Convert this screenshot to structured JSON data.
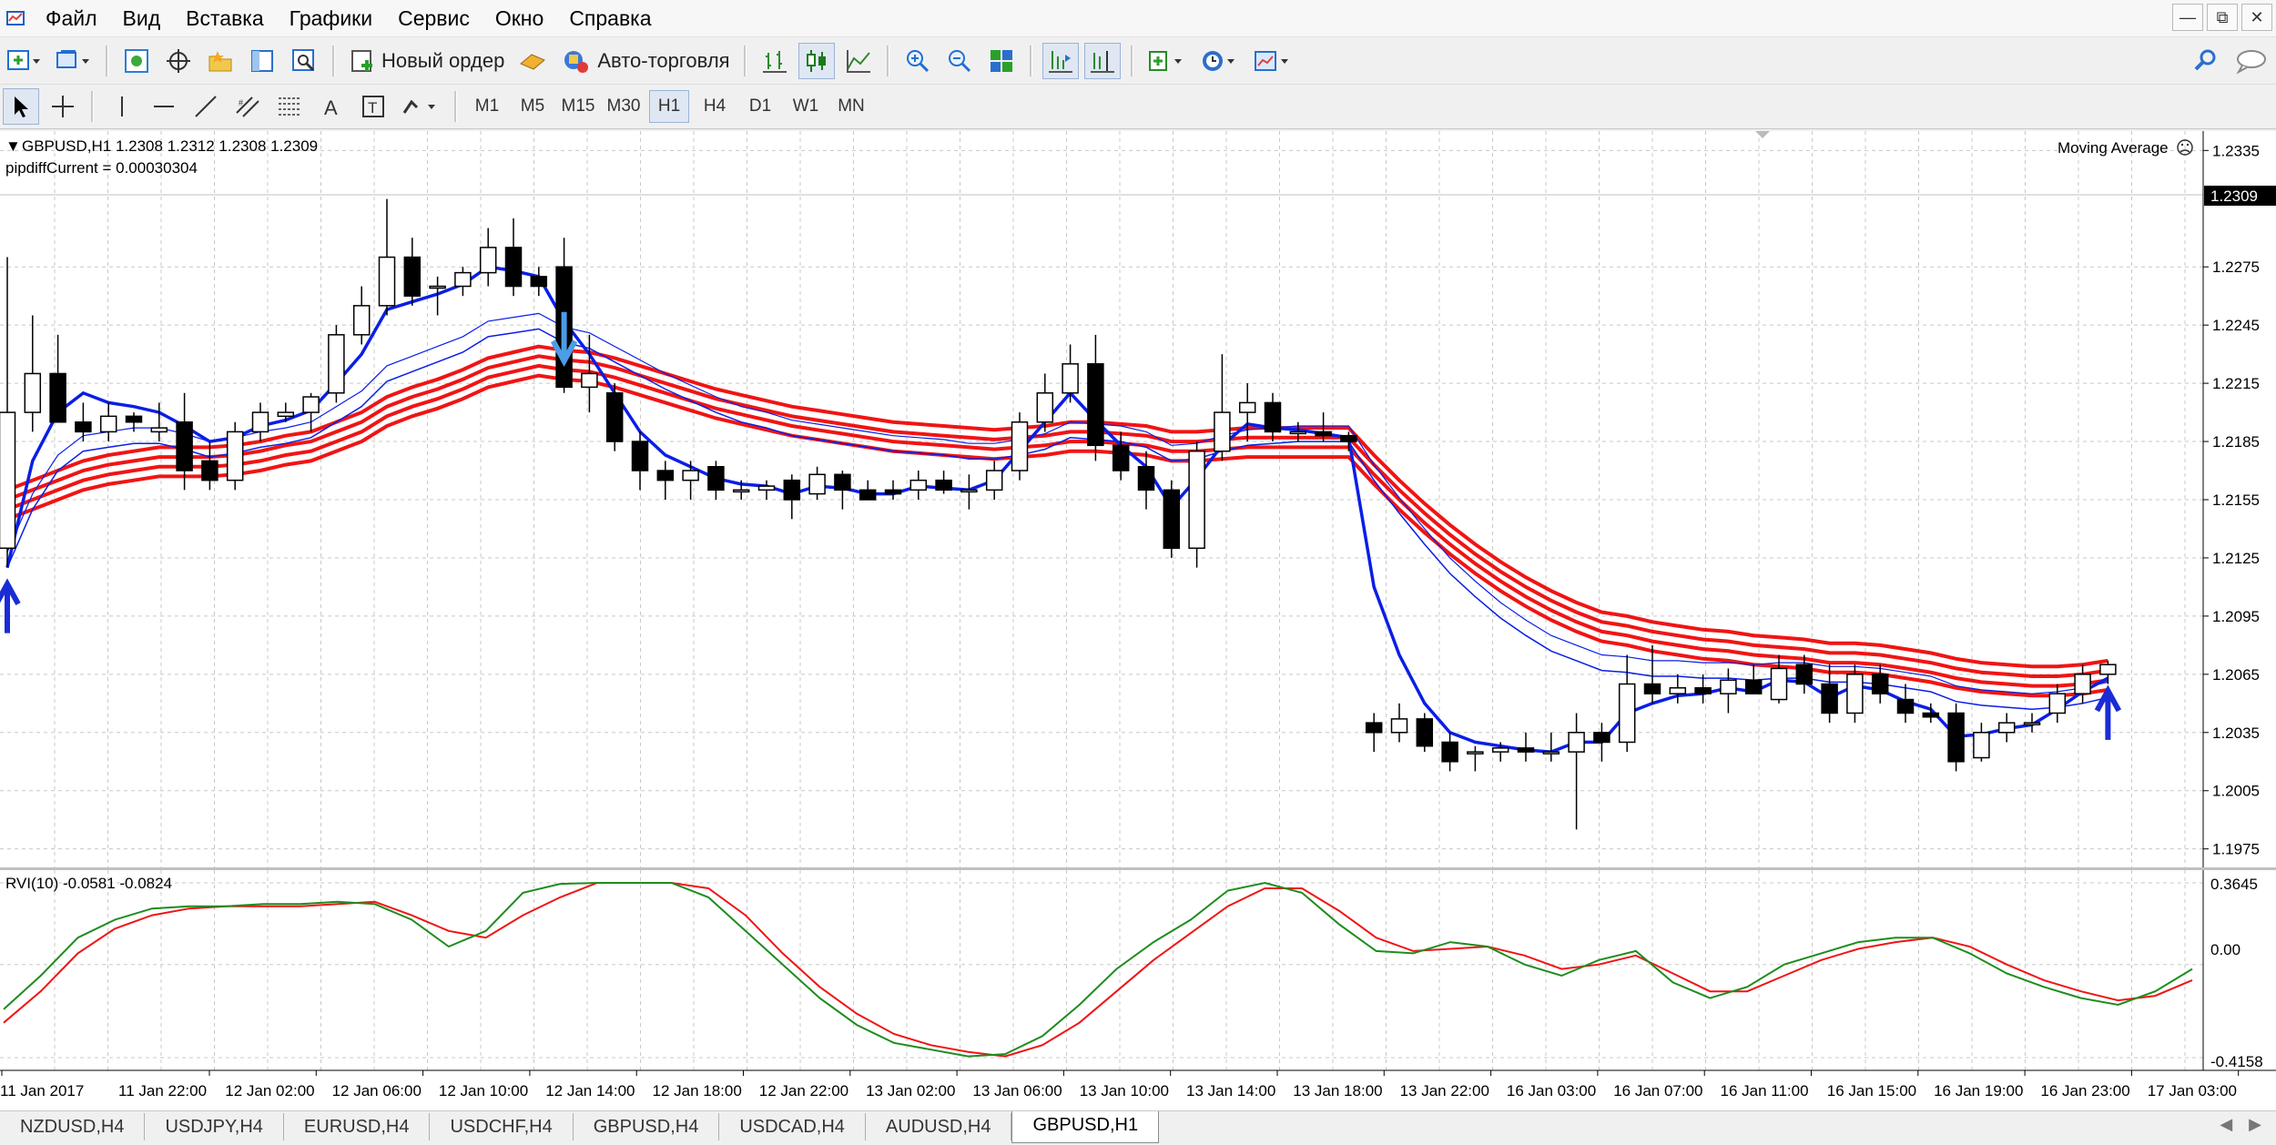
{
  "menu": {
    "items": [
      "Файл",
      "Вид",
      "Вставка",
      "Графики",
      "Сервис",
      "Окно",
      "Справка"
    ]
  },
  "toolbar": {
    "new_order_label": "Новый ордер",
    "auto_trading_label": "Авто-торговля"
  },
  "timeframes": [
    "M1",
    "M5",
    "M15",
    "M30",
    "H1",
    "H4",
    "D1",
    "W1",
    "MN"
  ],
  "active_timeframe": "H1",
  "chart": {
    "symbol_info": "GBPUSD,H1  1.2308 1.2312 1.2308 1.2309",
    "pipdiff": "pipdiffCurrent = 0.00030304",
    "indicator_label": "Moving Average",
    "current_price": "1.2309",
    "price_ticks": [
      "1.2335",
      "1.2275",
      "1.2245",
      "1.2215",
      "1.2185",
      "1.2155",
      "1.2125",
      "1.2095",
      "1.2065",
      "1.2035",
      "1.2005",
      "1.1975"
    ],
    "time_ticks": [
      "11 Jan 2017",
      "11 Jan 22:00",
      "12 Jan 02:00",
      "12 Jan 06:00",
      "12 Jan 10:00",
      "12 Jan 14:00",
      "12 Jan 18:00",
      "12 Jan 22:00",
      "13 Jan 02:00",
      "13 Jan 06:00",
      "13 Jan 10:00",
      "13 Jan 14:00",
      "13 Jan 18:00",
      "13 Jan 22:00",
      "16 Jan 03:00",
      "16 Jan 07:00",
      "16 Jan 11:00",
      "16 Jan 15:00",
      "16 Jan 19:00",
      "16 Jan 23:00",
      "17 Jan 03:00"
    ],
    "rvi_label": "RVI(10) -0.0581 -0.0824",
    "rvi_ticks": [
      "0.3645",
      "0.00",
      "-0.4158"
    ]
  },
  "colors": {
    "bull": "#ffffff",
    "bear": "#000000",
    "ma_blue": "#0a1ee6",
    "ma_red": "#f01414",
    "rvi_main": "#1e8c1e",
    "rvi_signal": "#f01414",
    "arrow_up": "#1a2cd6",
    "arrow_down": "#4a9de6"
  },
  "chart_data": {
    "type": "candlestick",
    "symbol": "GBPUSD",
    "timeframe": "H1",
    "ylim": [
      1.1965,
      1.2345
    ],
    "candles": [
      {
        "o": 1.213,
        "h": 1.228,
        "l": 1.212,
        "c": 1.22
      },
      {
        "o": 1.22,
        "h": 1.225,
        "l": 1.219,
        "c": 1.222
      },
      {
        "o": 1.222,
        "h": 1.224,
        "l": 1.22,
        "c": 1.2195
      },
      {
        "o": 1.2195,
        "h": 1.2205,
        "l": 1.2185,
        "c": 1.219
      },
      {
        "o": 1.219,
        "h": 1.2205,
        "l": 1.2185,
        "c": 1.2198
      },
      {
        "o": 1.2198,
        "h": 1.22,
        "l": 1.219,
        "c": 1.2195
      },
      {
        "o": 1.219,
        "h": 1.2205,
        "l": 1.2185,
        "c": 1.2192
      },
      {
        "o": 1.2195,
        "h": 1.221,
        "l": 1.216,
        "c": 1.217
      },
      {
        "o": 1.2175,
        "h": 1.2185,
        "l": 1.216,
        "c": 1.2165
      },
      {
        "o": 1.2165,
        "h": 1.2195,
        "l": 1.216,
        "c": 1.219
      },
      {
        "o": 1.219,
        "h": 1.2205,
        "l": 1.2185,
        "c": 1.22
      },
      {
        "o": 1.2198,
        "h": 1.2205,
        "l": 1.2195,
        "c": 1.22
      },
      {
        "o": 1.22,
        "h": 1.221,
        "l": 1.219,
        "c": 1.2208
      },
      {
        "o": 1.221,
        "h": 1.2245,
        "l": 1.2205,
        "c": 1.224
      },
      {
        "o": 1.224,
        "h": 1.2265,
        "l": 1.2235,
        "c": 1.2255
      },
      {
        "o": 1.2255,
        "h": 1.231,
        "l": 1.225,
        "c": 1.228
      },
      {
        "o": 1.228,
        "h": 1.229,
        "l": 1.2255,
        "c": 1.226
      },
      {
        "o": 1.2265,
        "h": 1.227,
        "l": 1.225,
        "c": 1.2265
      },
      {
        "o": 1.2265,
        "h": 1.2275,
        "l": 1.226,
        "c": 1.2272
      },
      {
        "o": 1.2272,
        "h": 1.2295,
        "l": 1.2265,
        "c": 1.2285
      },
      {
        "o": 1.2285,
        "h": 1.23,
        "l": 1.226,
        "c": 1.2265
      },
      {
        "o": 1.227,
        "h": 1.2275,
        "l": 1.226,
        "c": 1.2265
      },
      {
        "o": 1.2275,
        "h": 1.229,
        "l": 1.221,
        "c": 1.2213
      },
      {
        "o": 1.2213,
        "h": 1.224,
        "l": 1.22,
        "c": 1.222
      },
      {
        "o": 1.221,
        "h": 1.2215,
        "l": 1.218,
        "c": 1.2185
      },
      {
        "o": 1.2185,
        "h": 1.219,
        "l": 1.216,
        "c": 1.217
      },
      {
        "o": 1.217,
        "h": 1.2175,
        "l": 1.2155,
        "c": 1.2165
      },
      {
        "o": 1.2165,
        "h": 1.2175,
        "l": 1.2155,
        "c": 1.217
      },
      {
        "o": 1.2172,
        "h": 1.2175,
        "l": 1.2155,
        "c": 1.216
      },
      {
        "o": 1.216,
        "h": 1.2165,
        "l": 1.2155,
        "c": 1.216
      },
      {
        "o": 1.216,
        "h": 1.2165,
        "l": 1.2155,
        "c": 1.2162
      },
      {
        "o": 1.2165,
        "h": 1.2168,
        "l": 1.2145,
        "c": 1.2155
      },
      {
        "o": 1.2158,
        "h": 1.2172,
        "l": 1.2155,
        "c": 1.2168
      },
      {
        "o": 1.2168,
        "h": 1.217,
        "l": 1.215,
        "c": 1.216
      },
      {
        "o": 1.216,
        "h": 1.2165,
        "l": 1.2155,
        "c": 1.2155
      },
      {
        "o": 1.216,
        "h": 1.2165,
        "l": 1.2155,
        "c": 1.2158
      },
      {
        "o": 1.216,
        "h": 1.217,
        "l": 1.2155,
        "c": 1.2165
      },
      {
        "o": 1.2165,
        "h": 1.217,
        "l": 1.2158,
        "c": 1.216
      },
      {
        "o": 1.216,
        "h": 1.2168,
        "l": 1.215,
        "c": 1.216
      },
      {
        "o": 1.216,
        "h": 1.2175,
        "l": 1.2155,
        "c": 1.217
      },
      {
        "o": 1.217,
        "h": 1.22,
        "l": 1.2165,
        "c": 1.2195
      },
      {
        "o": 1.2195,
        "h": 1.222,
        "l": 1.219,
        "c": 1.221
      },
      {
        "o": 1.221,
        "h": 1.2235,
        "l": 1.2205,
        "c": 1.2225
      },
      {
        "o": 1.2225,
        "h": 1.224,
        "l": 1.2175,
        "c": 1.2183
      },
      {
        "o": 1.2183,
        "h": 1.219,
        "l": 1.2165,
        "c": 1.217
      },
      {
        "o": 1.2172,
        "h": 1.218,
        "l": 1.215,
        "c": 1.216
      },
      {
        "o": 1.216,
        "h": 1.2165,
        "l": 1.2125,
        "c": 1.213
      },
      {
        "o": 1.213,
        "h": 1.2185,
        "l": 1.212,
        "c": 1.218
      },
      {
        "o": 1.218,
        "h": 1.223,
        "l": 1.2175,
        "c": 1.22
      },
      {
        "o": 1.22,
        "h": 1.2215,
        "l": 1.2185,
        "c": 1.2205
      },
      {
        "o": 1.2205,
        "h": 1.221,
        "l": 1.2185,
        "c": 1.219
      },
      {
        "o": 1.219,
        "h": 1.2195,
        "l": 1.2185,
        "c": 1.219
      },
      {
        "o": 1.219,
        "h": 1.22,
        "l": 1.2185,
        "c": 1.2188
      },
      {
        "o": 1.2188,
        "h": 1.219,
        "l": 1.218,
        "c": 1.2185
      },
      {
        "o": 1.204,
        "h": 1.2045,
        "l": 1.2025,
        "c": 1.2035
      },
      {
        "o": 1.2035,
        "h": 1.205,
        "l": 1.203,
        "c": 1.2042
      },
      {
        "o": 1.2042,
        "h": 1.2045,
        "l": 1.2025,
        "c": 1.2028
      },
      {
        "o": 1.203,
        "h": 1.2035,
        "l": 1.2015,
        "c": 1.202
      },
      {
        "o": 1.2025,
        "h": 1.2028,
        "l": 1.2015,
        "c": 1.2025
      },
      {
        "o": 1.2025,
        "h": 1.203,
        "l": 1.202,
        "c": 1.2027
      },
      {
        "o": 1.2027,
        "h": 1.2035,
        "l": 1.202,
        "c": 1.2025
      },
      {
        "o": 1.2025,
        "h": 1.2035,
        "l": 1.202,
        "c": 1.2025
      },
      {
        "o": 1.2025,
        "h": 1.2045,
        "l": 1.1985,
        "c": 1.2035
      },
      {
        "o": 1.2035,
        "h": 1.204,
        "l": 1.202,
        "c": 1.203
      },
      {
        "o": 1.203,
        "h": 1.2075,
        "l": 1.2025,
        "c": 1.206
      },
      {
        "o": 1.206,
        "h": 1.208,
        "l": 1.205,
        "c": 1.2055
      },
      {
        "o": 1.2055,
        "h": 1.2065,
        "l": 1.205,
        "c": 1.2058
      },
      {
        "o": 1.2058,
        "h": 1.2065,
        "l": 1.205,
        "c": 1.2055
      },
      {
        "o": 1.2055,
        "h": 1.2068,
        "l": 1.2045,
        "c": 1.2062
      },
      {
        "o": 1.2062,
        "h": 1.207,
        "l": 1.2055,
        "c": 1.2055
      },
      {
        "o": 1.2052,
        "h": 1.2075,
        "l": 1.205,
        "c": 1.2068
      },
      {
        "o": 1.207,
        "h": 1.2075,
        "l": 1.2055,
        "c": 1.206
      },
      {
        "o": 1.206,
        "h": 1.207,
        "l": 1.204,
        "c": 1.2045
      },
      {
        "o": 1.2045,
        "h": 1.207,
        "l": 1.204,
        "c": 1.2065
      },
      {
        "o": 1.2065,
        "h": 1.207,
        "l": 1.205,
        "c": 1.2055
      },
      {
        "o": 1.2052,
        "h": 1.206,
        "l": 1.204,
        "c": 1.2045
      },
      {
        "o": 1.2045,
        "h": 1.205,
        "l": 1.204,
        "c": 1.2043
      },
      {
        "o": 1.2045,
        "h": 1.205,
        "l": 1.2015,
        "c": 1.202
      },
      {
        "o": 1.2022,
        "h": 1.204,
        "l": 1.202,
        "c": 1.2035
      },
      {
        "o": 1.2035,
        "h": 1.2045,
        "l": 1.203,
        "c": 1.204
      },
      {
        "o": 1.204,
        "h": 1.2045,
        "l": 1.2035,
        "c": 1.204
      },
      {
        "o": 1.2045,
        "h": 1.206,
        "l": 1.204,
        "c": 1.2055
      },
      {
        "o": 1.2055,
        "h": 1.207,
        "l": 1.205,
        "c": 1.2065
      },
      {
        "o": 1.2065,
        "h": 1.2072,
        "l": 1.206,
        "c": 1.207
      }
    ],
    "ma_blue_fast": [
      1.212,
      1.2175,
      1.22,
      1.221,
      1.2205,
      1.2203,
      1.22,
      1.2193,
      1.2185,
      1.2187,
      1.2193,
      1.2196,
      1.2201,
      1.2215,
      1.223,
      1.2253,
      1.2257,
      1.2261,
      1.2266,
      1.2275,
      1.2273,
      1.227,
      1.2247,
      1.223,
      1.221,
      1.219,
      1.2178,
      1.2172,
      1.2166,
      1.2163,
      1.2162,
      1.2158,
      1.2162,
      1.2161,
      1.2158,
      1.2158,
      1.2162,
      1.2161,
      1.216,
      1.2165,
      1.218,
      1.2195,
      1.221,
      1.2196,
      1.2183,
      1.2172,
      1.2151,
      1.2166,
      1.2183,
      1.2194,
      1.2192,
      1.2191,
      1.2189,
      1.2187,
      1.211,
      1.2075,
      1.205,
      1.2035,
      1.203,
      1.2028,
      1.2026,
      1.2025,
      1.203,
      1.203,
      1.2045,
      1.205,
      1.2054,
      1.2055,
      1.2058,
      1.2056,
      1.2062,
      1.2061,
      1.2053,
      1.2059,
      1.2057,
      1.2051,
      1.2047,
      1.2033,
      1.2034,
      1.2037,
      1.2039,
      1.2047,
      1.2056,
      1.2063
    ],
    "ma_blue_slow": [
      1.212,
      1.215,
      1.217,
      1.218,
      1.2182,
      1.2184,
      1.2184,
      1.2181,
      1.2177,
      1.2179,
      1.2182,
      1.2184,
      1.2187,
      1.2195,
      1.2203,
      1.2216,
      1.2221,
      1.2226,
      1.2231,
      1.2239,
      1.2241,
      1.2243,
      1.2236,
      1.2233,
      1.2226,
      1.2219,
      1.2212,
      1.2206,
      1.22,
      1.2195,
      1.2192,
      1.2188,
      1.2186,
      1.2184,
      1.2182,
      1.218,
      1.2179,
      1.2178,
      1.2176,
      1.2176,
      1.2178,
      1.2181,
      1.2187,
      1.2186,
      1.2185,
      1.2182,
      1.2175,
      1.2176,
      1.218,
      1.2183,
      1.2184,
      1.2185,
      1.2185,
      1.2185,
      1.2165,
      1.2148,
      1.2132,
      1.2117,
      1.2105,
      1.2094,
      1.2085,
      1.2077,
      1.2072,
      1.2067,
      1.2066,
      1.2064,
      1.2064,
      1.2063,
      1.2063,
      1.2062,
      1.2063,
      1.2063,
      1.2061,
      1.2061,
      1.206,
      1.2058,
      1.2056,
      1.2051,
      1.2049,
      1.2048,
      1.2047,
      1.2048,
      1.205,
      1.2053
    ],
    "ma_red": [
      1.215,
      1.2155,
      1.216,
      1.2165,
      1.2168,
      1.217,
      1.2172,
      1.2172,
      1.2172,
      1.2173,
      1.2175,
      1.2178,
      1.218,
      1.2185,
      1.219,
      1.2198,
      1.2203,
      1.2207,
      1.2212,
      1.2218,
      1.2221,
      1.2224,
      1.2222,
      1.2221,
      1.2218,
      1.2214,
      1.221,
      1.2206,
      1.2202,
      1.2199,
      1.2196,
      1.2193,
      1.2191,
      1.2189,
      1.2187,
      1.2185,
      1.2184,
      1.2183,
      1.2182,
      1.2181,
      1.2182,
      1.2183,
      1.2185,
      1.2185,
      1.2184,
      1.2183,
      1.218,
      1.218,
      1.2181,
      1.2182,
      1.2182,
      1.2182,
      1.2182,
      1.2182,
      1.2168,
      1.2155,
      1.2143,
      1.2132,
      1.2122,
      1.2113,
      1.2105,
      1.2098,
      1.2092,
      1.2087,
      1.2085,
      1.2082,
      1.208,
      1.2078,
      1.2077,
      1.2075,
      1.2074,
      1.2073,
      1.2071,
      1.2071,
      1.207,
      1.2068,
      1.2066,
      1.2063,
      1.2061,
      1.206,
      1.2059,
      1.2059,
      1.206,
      1.2062
    ],
    "ma_red_spread": [
      -0.0005,
      0.0,
      0.0005,
      0.001
    ],
    "arrows": [
      {
        "index": 0,
        "dir": "up",
        "price": 1.2105
      },
      {
        "index": 22,
        "dir": "down",
        "price": 1.2233
      },
      {
        "index": 83,
        "dir": "up",
        "price": 1.205
      }
    ],
    "rvi": {
      "ylim": [
        -0.4158,
        0.3645
      ],
      "main": [
        -0.2,
        -0.05,
        0.12,
        0.2,
        0.25,
        0.26,
        0.26,
        0.27,
        0.27,
        0.28,
        0.27,
        0.2,
        0.08,
        0.15,
        0.32,
        0.36,
        0.42,
        0.45,
        0.4,
        0.3,
        0.15,
        0.0,
        -0.15,
        -0.27,
        -0.35,
        -0.38,
        -0.41,
        -0.4,
        -0.32,
        -0.18,
        -0.02,
        0.1,
        0.2,
        0.33,
        0.38,
        0.32,
        0.18,
        0.06,
        0.05,
        0.1,
        0.08,
        0.0,
        -0.05,
        0.02,
        0.06,
        -0.08,
        -0.15,
        -0.1,
        0.0,
        0.05,
        0.1,
        0.12,
        0.12,
        0.05,
        -0.04,
        -0.1,
        -0.15,
        -0.18,
        -0.12,
        -0.02
      ],
      "signal": [
        -0.26,
        -0.12,
        0.05,
        0.16,
        0.22,
        0.25,
        0.26,
        0.26,
        0.26,
        0.27,
        0.28,
        0.22,
        0.15,
        0.12,
        0.22,
        0.3,
        0.38,
        0.42,
        0.42,
        0.34,
        0.22,
        0.05,
        -0.1,
        -0.22,
        -0.31,
        -0.36,
        -0.39,
        -0.41,
        -0.36,
        -0.26,
        -0.12,
        0.02,
        0.14,
        0.26,
        0.34,
        0.34,
        0.24,
        0.12,
        0.06,
        0.07,
        0.08,
        0.04,
        -0.02,
        0.0,
        0.04,
        -0.04,
        -0.12,
        -0.12,
        -0.05,
        0.02,
        0.07,
        0.1,
        0.12,
        0.08,
        0.0,
        -0.07,
        -0.12,
        -0.16,
        -0.14,
        -0.07
      ]
    }
  },
  "symbol_tabs": [
    "NZDUSD,H4",
    "USDJPY,H4",
    "EURUSD,H4",
    "USDCHF,H4",
    "GBPUSD,H4",
    "USDCAD,H4",
    "AUDUSD,H4",
    "GBPUSD,H1"
  ],
  "active_tab": "GBPUSD,H1"
}
